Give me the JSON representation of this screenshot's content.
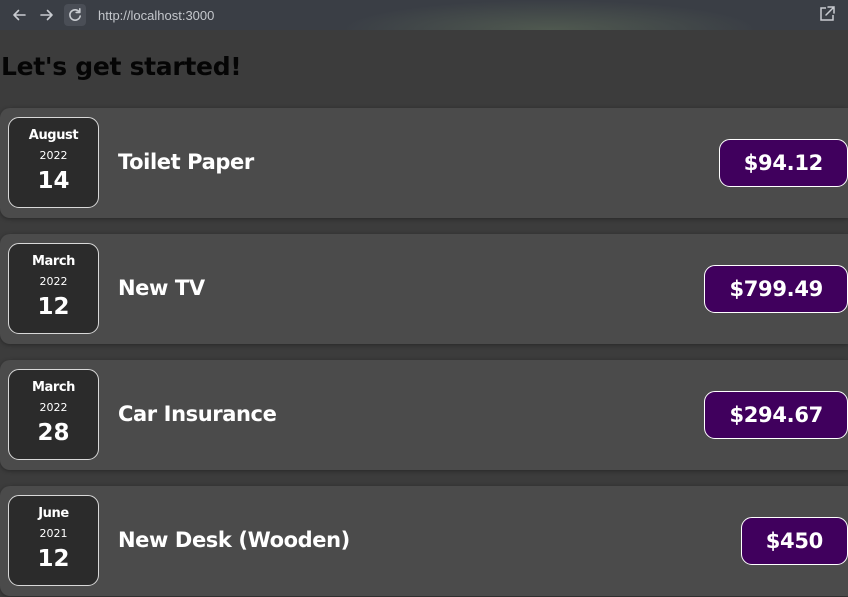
{
  "browser": {
    "url": "http://localhost:3000",
    "icons": [
      "back-arrow-icon",
      "forward-arrow-icon",
      "reload-icon",
      "open-external-icon"
    ]
  },
  "page": {
    "title": "Let's get started!"
  },
  "expenses": [
    {
      "month": "August",
      "year": "2022",
      "day": "14",
      "title": "Toilet Paper",
      "amount": "$94.12"
    },
    {
      "month": "March",
      "year": "2022",
      "day": "12",
      "title": "New TV",
      "amount": "$799.49"
    },
    {
      "month": "March",
      "year": "2022",
      "day": "28",
      "title": "Car Insurance",
      "amount": "$294.67"
    },
    {
      "month": "June",
      "year": "2021",
      "day": "12",
      "title": "New Desk (Wooden)",
      "amount": "$450"
    }
  ],
  "colors": {
    "page_background": "#3c3c3c",
    "card_background": "#4b4b4b",
    "date_background": "#2b2b2b",
    "price_background": "#40005d",
    "title_text": "#050505"
  }
}
